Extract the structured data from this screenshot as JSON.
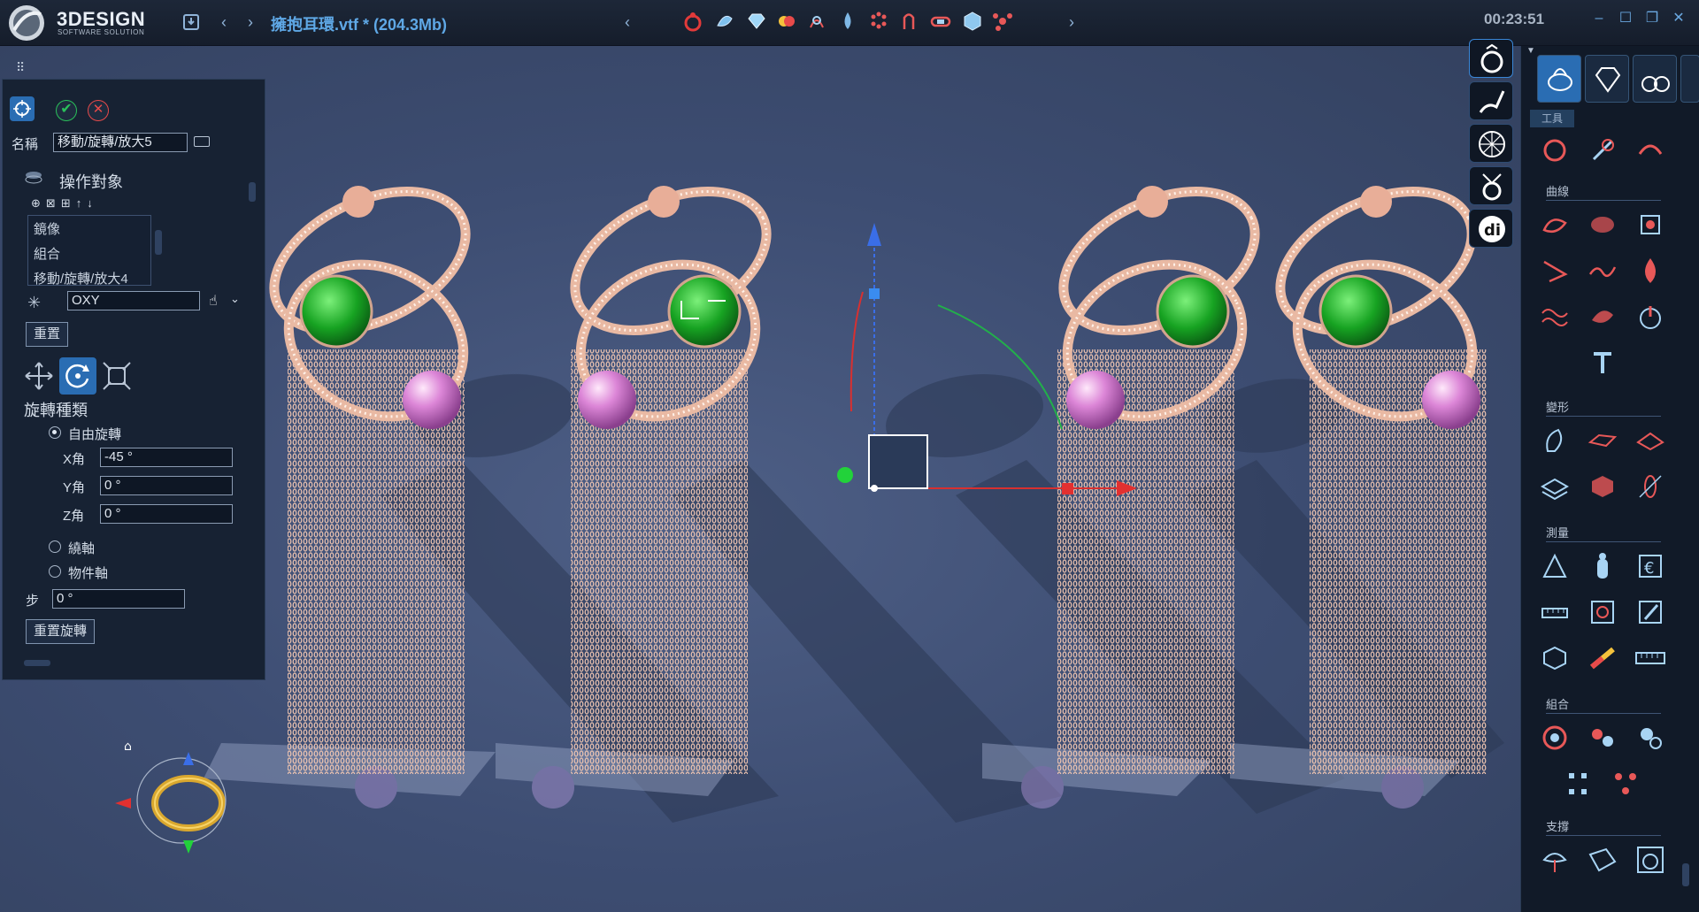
{
  "title_bar": {
    "brand": "3DESIGN",
    "brand_sub": "SOFTWARE SOLUTION",
    "file_title": "擁抱耳環.vtf * (204.3Mb)",
    "timer": "00:23:51"
  },
  "left_panel": {
    "name_label": "名稱",
    "name_value": "移動/旋轉/放大5",
    "operate_label": "操作對象",
    "operate_list": [
      "鏡像",
      "組合",
      "移動/旋轉/放大4"
    ],
    "plane_value": "OXY",
    "reset_label": "重置",
    "rotation_type_label": "旋轉種類",
    "free_rotation_label": "自由旋轉",
    "x_label": "X角",
    "x_value": "-45 °",
    "y_label": "Y角",
    "y_value": "0 °",
    "z_label": "Z角",
    "z_value": "0 °",
    "around_axis_label": "繞軸",
    "object_axis_label": "物件軸",
    "step_label": "步",
    "step_value": "0 °",
    "reset_rotation_label": "重置旋轉"
  },
  "tool_panel": {
    "tab_tools_label": "工具",
    "sections": [
      "曲線",
      "變形",
      "測量",
      "組合",
      "支撐"
    ]
  },
  "icons": {
    "save": "save-icon",
    "back": "arrow-left-icon",
    "forward": "arrow-right-icon",
    "ok": "check-icon",
    "cancel": "close-icon",
    "grid": "grid-icon"
  },
  "colors": {
    "accent": "#2a6db3",
    "title_text": "#5fa8e6",
    "emerald": "#1fa22e",
    "pearl": "#d77fd0",
    "rose_gold": "#e9b9a3"
  }
}
